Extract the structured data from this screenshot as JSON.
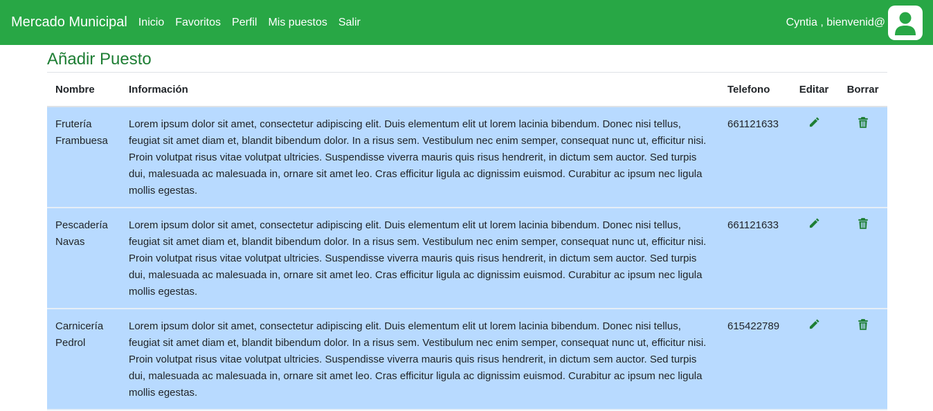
{
  "navbar": {
    "brand": "Mercado Municipal",
    "links": [
      "Inicio",
      "Favoritos",
      "Perfil",
      "Mis puestos",
      "Salir"
    ],
    "welcome": "Cyntia , bienvenid@",
    "avatar_icon": "user-icon"
  },
  "page_title": "Añadir Puesto",
  "table": {
    "headers": [
      "Nombre",
      "Información",
      "Telefono",
      "Editar",
      "Borrar"
    ],
    "rows": [
      {
        "nombre": "Frutería Frambuesa",
        "info": "Lorem ipsum dolor sit amet, consectetur adipiscing elit. Duis elementum elit ut lorem lacinia bibendum. Donec nisi tellus, feugiat sit amet diam et, blandit bibendum dolor. In a risus sem. Vestibulum nec enim semper, consequat nunc ut, efficitur nisi. Proin volutpat risus vitae volutpat ultricies. Suspendisse viverra mauris quis risus hendrerit, in dictum sem auctor. Sed turpis dui, malesuada ac malesuada in, ornare sit amet leo. Cras efficitur ligula ac dignissim euismod. Curabitur ac ipsum nec ligula mollis egestas.",
        "telefono": "661121633"
      },
      {
        "nombre": "Pescadería Navas",
        "info": "Lorem ipsum dolor sit amet, consectetur adipiscing elit. Duis elementum elit ut lorem lacinia bibendum. Donec nisi tellus, feugiat sit amet diam et, blandit bibendum dolor. In a risus sem. Vestibulum nec enim semper, consequat nunc ut, efficitur nisi. Proin volutpat risus vitae volutpat ultricies. Suspendisse viverra mauris quis risus hendrerit, in dictum sem auctor. Sed turpis dui, malesuada ac malesuada in, ornare sit amet leo. Cras efficitur ligula ac dignissim euismod. Curabitur ac ipsum nec ligula mollis egestas.",
        "telefono": "661121633"
      },
      {
        "nombre": "Carnicería Pedrol",
        "info": "Lorem ipsum dolor sit amet, consectetur adipiscing elit. Duis elementum elit ut lorem lacinia bibendum. Donec nisi tellus, feugiat sit amet diam et, blandit bibendum dolor. In a risus sem. Vestibulum nec enim semper, consequat nunc ut, efficitur nisi. Proin volutpat risus vitae volutpat ultricies. Suspendisse viverra mauris quis risus hendrerit, in dictum sem auctor. Sed turpis dui, malesuada ac malesuada in, ornare sit amet leo. Cras efficitur ligula ac dignissim euismod. Curabitur ac ipsum nec ligula mollis egestas.",
        "telefono": "615422789"
      }
    ],
    "edit_icon": "pencil-icon",
    "delete_icon": "trash-icon"
  },
  "colors": {
    "navbar_bg": "#28a745",
    "title_text": "#1e7e34",
    "row_bg": "#b8daff",
    "icon_green": "#1e7e34"
  }
}
